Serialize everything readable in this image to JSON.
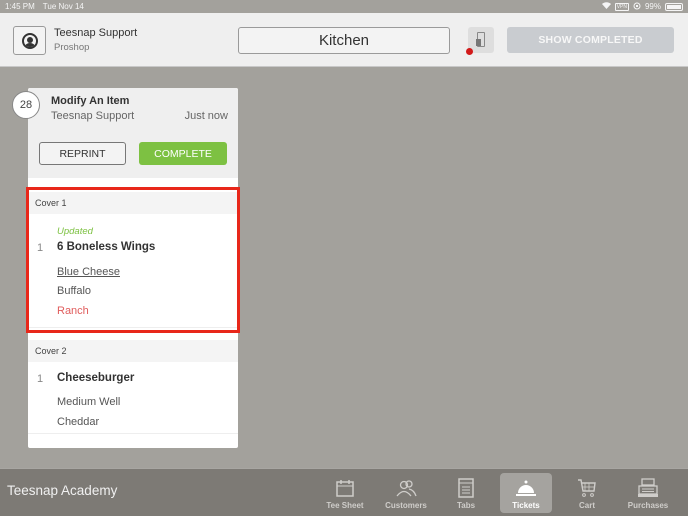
{
  "status_bar": {
    "time": "1:45 PM",
    "date": "Tue Nov 14",
    "vpn": "VPN",
    "battery": "99%",
    "battery_level": 0.99
  },
  "header": {
    "user_name": "Teesnap Support",
    "user_role": "Proshop",
    "station": "Kitchen",
    "show_completed_label": "SHOW COMPLETED",
    "printer_alert": true
  },
  "ticket": {
    "number": "28",
    "title": "Modify An Item",
    "user": "Teesnap Support",
    "time": "Just now",
    "reprint_label": "REPRINT",
    "complete_label": "COMPLETE",
    "covers": [
      {
        "label": "Cover 1",
        "items": [
          {
            "status": "Updated",
            "qty": "1",
            "name": "6 Boneless Wings",
            "modifiers": [
              {
                "text": "Blue Cheese",
                "state": "changed"
              },
              {
                "text": "Buffalo",
                "state": "normal"
              },
              {
                "text": "Ranch",
                "state": "removed"
              }
            ]
          }
        ]
      },
      {
        "label": "Cover 2",
        "items": [
          {
            "qty": "1",
            "name": "Cheeseburger",
            "modifiers": [
              {
                "text": "Medium Well",
                "state": "normal"
              },
              {
                "text": "Cheddar",
                "state": "normal"
              }
            ]
          }
        ]
      }
    ]
  },
  "bottom_bar": {
    "brand": "Teesnap Academy",
    "tabs": [
      {
        "label": "Tee Sheet",
        "icon": "calendar-icon",
        "active": false
      },
      {
        "label": "Customers",
        "icon": "users-icon",
        "active": false
      },
      {
        "label": "Tabs",
        "icon": "receipt-icon",
        "active": false
      },
      {
        "label": "Tickets",
        "icon": "cloche-icon",
        "active": true
      },
      {
        "label": "Cart",
        "icon": "cart-icon",
        "active": false
      },
      {
        "label": "Purchases",
        "icon": "cash-register-icon",
        "active": false
      }
    ]
  },
  "colors": {
    "accent_green": "#7dc142",
    "removed_red": "#e05c5c",
    "highlight_red": "#e8271a",
    "alert_red": "#d21a1a"
  }
}
